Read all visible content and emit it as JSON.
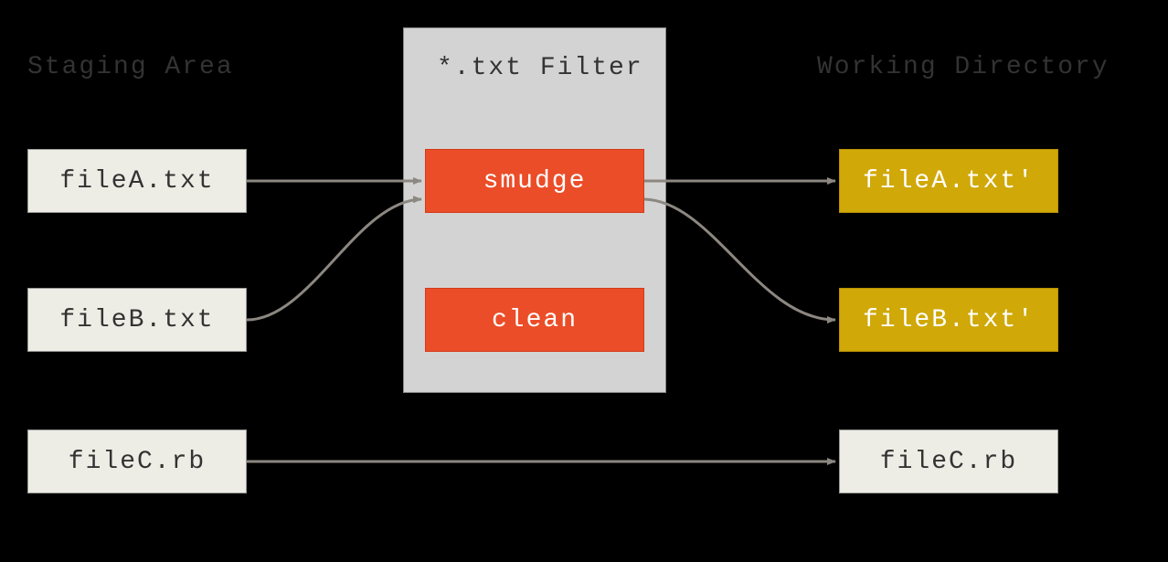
{
  "headers": {
    "staging": "Staging Area",
    "filter": "*.txt Filter",
    "working": "Working Directory"
  },
  "staging_files": {
    "fileA": "fileA.txt",
    "fileB": "fileB.txt",
    "fileC": "fileC.rb"
  },
  "filter_ops": {
    "smudge": "smudge",
    "clean": "clean"
  },
  "working_files": {
    "fileA": "fileA.txt'",
    "fileB": "fileB.txt'",
    "fileC": "fileC.rb"
  },
  "colors": {
    "background": "#000000",
    "box_light": "#eeede5",
    "box_orange": "#eb4d28",
    "box_yellow": "#d0a808",
    "filter_bg": "#d3d3d3",
    "arrow": "#8c8781"
  }
}
